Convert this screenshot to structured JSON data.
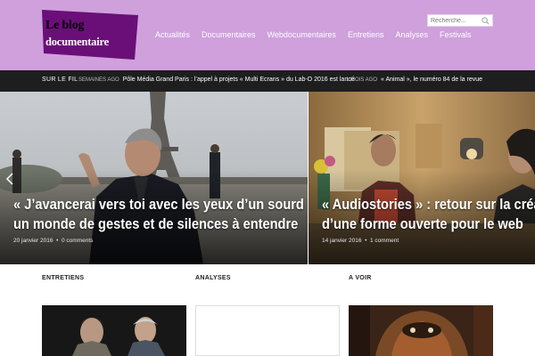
{
  "logo": {
    "line1": "Le blog",
    "line2": "documentaire"
  },
  "nav": [
    "Actualités",
    "Documentaires",
    "Webdocumentaires",
    "Entretiens",
    "Analyses",
    "Festivals"
  ],
  "search": {
    "placeholder": "Recherche..."
  },
  "ticker": {
    "label": "SUR LE FIL",
    "items": [
      {
        "ago": "SEMAINES AGO",
        "text": "Pôle Média Grand Paris : l’appel à projets « Multi Ecrans » du Lab-O 2016 est lancé"
      },
      {
        "ago": "1 MOIS AGO",
        "text": "« Animal », le numéro 84 de la revue"
      }
    ]
  },
  "hero": [
    {
      "title_line1": "« J’avancerai vers toi avec les yeux d’un sourd » :",
      "title_line2": "un monde de gestes et de silences à entendre",
      "date": "20 janvier 2016",
      "comments": "0 comments"
    },
    {
      "title_line1": "« Audiostories » : retour sur la création",
      "title_line2": "d’une forme ouverte pour le web",
      "date": "14 janvier 2016",
      "comments": "1 comment"
    }
  ],
  "sections": [
    "ENTRETIENS",
    "ANALYSES",
    "A VOIR"
  ],
  "colors": {
    "header": "#cfa0dc",
    "logo_bg": "#6a0f78",
    "ticker": "#1e1e1e"
  }
}
